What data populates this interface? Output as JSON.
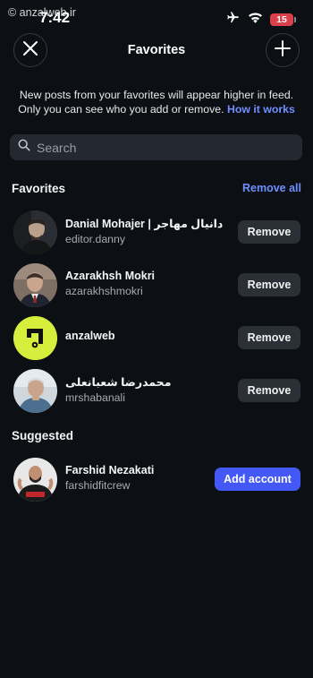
{
  "status_bar": {
    "watermark": "© anzalweb.ir",
    "time": "7:42",
    "battery": "15",
    "icons": [
      "airplane-icon",
      "wifi-icon",
      "battery-icon"
    ]
  },
  "header": {
    "title": "Favorites",
    "close_icon": "close-icon",
    "add_icon": "plus-icon"
  },
  "info": {
    "line1": "New posts from your favorites will appear higher in feed.",
    "line2": "Only you can see who you add or remove.",
    "link": "How it works"
  },
  "search": {
    "placeholder": "Search",
    "value": ""
  },
  "favorites": {
    "title": "Favorites",
    "remove_all": "Remove all",
    "items": [
      {
        "name": "Danial Mohajer | دانیال مهاجر",
        "username": "editor.danny",
        "action": "Remove"
      },
      {
        "name": "Azarakhsh Mokri",
        "username": "azarakhshmokri",
        "action": "Remove"
      },
      {
        "name": "anzalweb",
        "username": "",
        "action": "Remove"
      },
      {
        "name": "محمدرضا شعبانعلی",
        "username": "mrshabanali",
        "action": "Remove"
      }
    ]
  },
  "suggested": {
    "title": "Suggested",
    "items": [
      {
        "name": "Farshid Nezakati",
        "username": "farshidfitcrew",
        "action": "Add account"
      }
    ]
  },
  "colors": {
    "background": "#0c0f14",
    "accent_link": "#6f8fff",
    "primary_button": "#4458f5",
    "secondary_button": "#2b2f36",
    "battery_low": "#d9404c"
  }
}
